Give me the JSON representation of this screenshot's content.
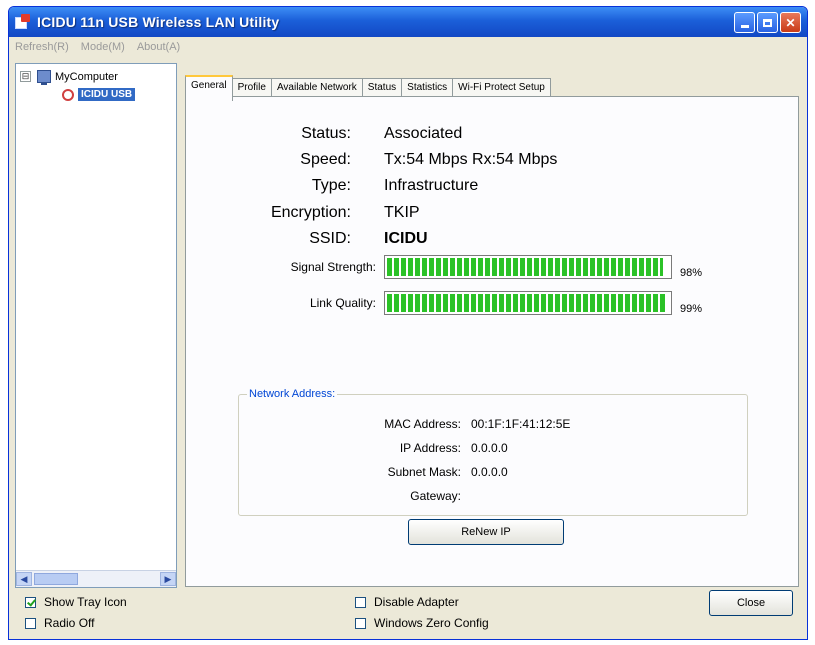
{
  "window": {
    "title": "ICIDU 11n USB Wireless LAN Utility"
  },
  "menu": {
    "items": [
      "Refresh(R)",
      "Mode(M)",
      "About(A)"
    ]
  },
  "tree": {
    "expander": "⊟",
    "root_label": "MyComputer",
    "child_label": "ICIDU USB"
  },
  "tabs": [
    {
      "label": "General",
      "active": true
    },
    {
      "label": "Profile",
      "active": false
    },
    {
      "label": "Available Network",
      "active": false
    },
    {
      "label": "Status",
      "active": false
    },
    {
      "label": "Statistics",
      "active": false
    },
    {
      "label": "Wi-Fi Protect Setup",
      "active": false
    }
  ],
  "general": {
    "status_label": "Status:",
    "status_value": "Associated",
    "speed_label": "Speed:",
    "speed_value": "Tx:54 Mbps Rx:54 Mbps",
    "type_label": "Type:",
    "type_value": "Infrastructure",
    "encryption_label": "Encryption:",
    "encryption_value": "TKIP",
    "ssid_label": "SSID:",
    "ssid_value": "ICIDU",
    "signal_label": "Signal Strength:",
    "signal_percent": 98,
    "signal_text": "98%",
    "link_label": "Link Quality:",
    "link_percent": 99,
    "link_text": "99%",
    "bar_color": "#2bc227"
  },
  "network": {
    "title": "Network Address:",
    "mac_label": "MAC Address:",
    "mac_value": "00:1F:1F:41:12:5E",
    "ip_label": "IP Address:",
    "ip_value": "0.0.0.0",
    "mask_label": "Subnet Mask:",
    "mask_value": "0.0.0.0",
    "gateway_label": "Gateway:",
    "gateway_value": ""
  },
  "buttons": {
    "renew": "ReNew IP",
    "close": "Close"
  },
  "options": {
    "show_tray_icon": {
      "label": "Show Tray Icon",
      "checked": true
    },
    "radio_off": {
      "label": "Radio Off",
      "checked": false
    },
    "disable_adapter": {
      "label": "Disable Adapter",
      "checked": false
    },
    "windows_zero_config": {
      "label": "Windows Zero Config",
      "checked": false
    }
  },
  "colors": {
    "titlebar": "#1b5fd9",
    "accent": "#0046d5",
    "selection": "#316ac5"
  }
}
